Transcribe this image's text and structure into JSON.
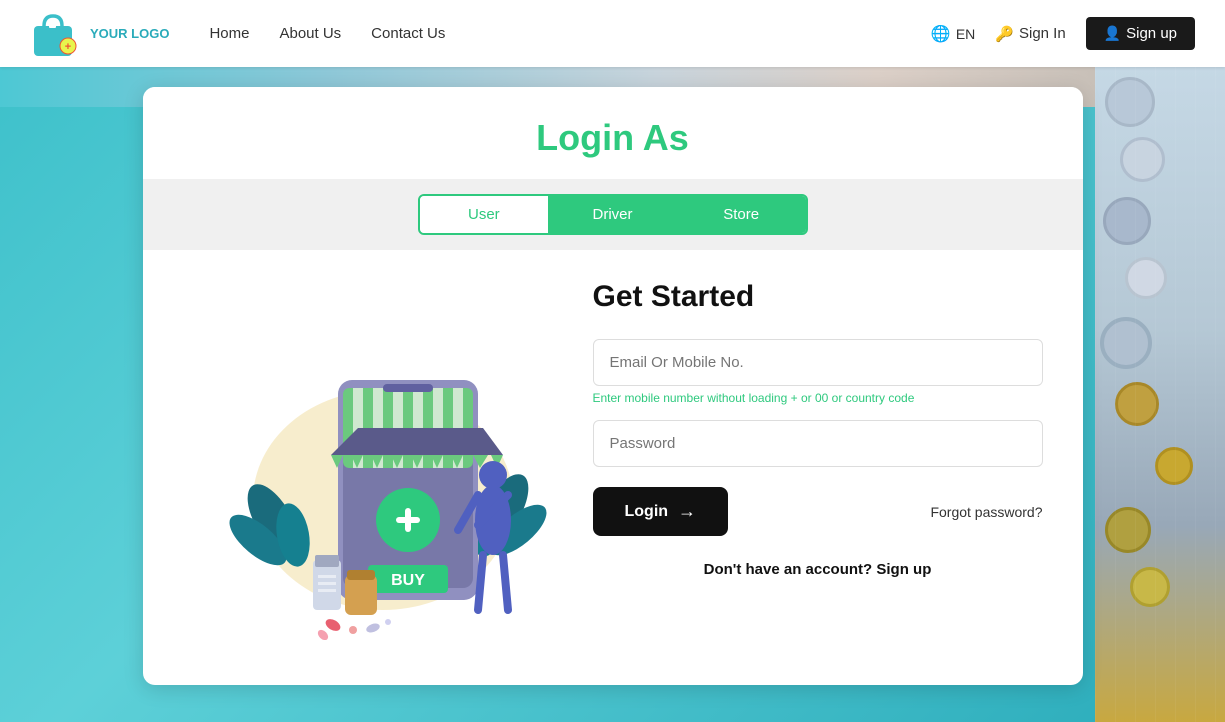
{
  "navbar": {
    "logo_text": "YOUR\nLOGO",
    "links": [
      {
        "label": "Home",
        "id": "home"
      },
      {
        "label": "About Us",
        "id": "about"
      },
      {
        "label": "Contact Us",
        "id": "contact"
      }
    ],
    "lang": "EN",
    "signin_label": "Sign In",
    "signup_label": "Sign up"
  },
  "login_card": {
    "title": "Login As",
    "tabs": [
      {
        "label": "User",
        "id": "user",
        "state": "active"
      },
      {
        "label": "Driver",
        "id": "driver",
        "state": "inactive"
      },
      {
        "label": "Store",
        "id": "store",
        "state": "inactive"
      }
    ],
    "form": {
      "heading": "Get Started",
      "email_placeholder": "Email Or Mobile No.",
      "email_hint_prefix": "Enter mobile number without loading ",
      "email_hint_highlight": "+ or 00 or country code",
      "password_placeholder": "Password",
      "login_button": "Login",
      "forgot_password": "Forgot password?",
      "no_account_text": "Don't have an account?",
      "signup_link": "Sign up"
    }
  }
}
